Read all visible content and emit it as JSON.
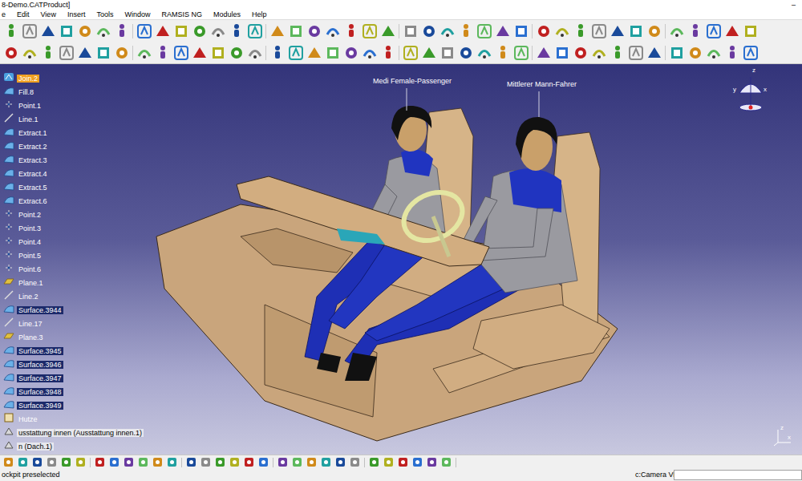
{
  "window": {
    "title": "8-Demo.CATProduct]",
    "minimize": "–"
  },
  "menu": [
    "e",
    "Edit",
    "View",
    "Insert",
    "Tools",
    "Window",
    "RAMSIS NG",
    "Modules",
    "Help"
  ],
  "tree": {
    "items": [
      {
        "label": "Join.2",
        "kind": "join",
        "selected": false,
        "current": true
      },
      {
        "label": "Fill.8",
        "kind": "surface",
        "selected": false,
        "current": false
      },
      {
        "label": "Point.1",
        "kind": "point",
        "selected": false,
        "current": false
      },
      {
        "label": "Line.1",
        "kind": "line",
        "selected": false,
        "current": false
      },
      {
        "label": "Extract.1",
        "kind": "surface",
        "selected": false,
        "current": false
      },
      {
        "label": "Extract.2",
        "kind": "surface",
        "selected": false,
        "current": false
      },
      {
        "label": "Extract.3",
        "kind": "surface",
        "selected": false,
        "current": false
      },
      {
        "label": "Extract.4",
        "kind": "surface",
        "selected": false,
        "current": false
      },
      {
        "label": "Extract.5",
        "kind": "surface",
        "selected": false,
        "current": false
      },
      {
        "label": "Extract.6",
        "kind": "surface",
        "selected": false,
        "current": false
      },
      {
        "label": "Point.2",
        "kind": "point",
        "selected": false,
        "current": false
      },
      {
        "label": "Point.3",
        "kind": "point",
        "selected": false,
        "current": false
      },
      {
        "label": "Point.4",
        "kind": "point",
        "selected": false,
        "current": false
      },
      {
        "label": "Point.5",
        "kind": "point",
        "selected": false,
        "current": false
      },
      {
        "label": "Point.6",
        "kind": "point",
        "selected": false,
        "current": false
      },
      {
        "label": "Plane.1",
        "kind": "plane",
        "selected": false,
        "current": false
      },
      {
        "label": "Line.2",
        "kind": "line",
        "selected": false,
        "current": false
      },
      {
        "label": "Surface.3944",
        "kind": "surface",
        "selected": true,
        "current": false
      },
      {
        "label": "Line.17",
        "kind": "line",
        "selected": false,
        "current": false
      },
      {
        "label": "Plane.3",
        "kind": "plane",
        "selected": false,
        "current": false
      },
      {
        "label": "Surface.3945",
        "kind": "surface",
        "selected": true,
        "current": false
      },
      {
        "label": "Surface.3946",
        "kind": "surface",
        "selected": true,
        "current": false
      },
      {
        "label": "Surface.3947",
        "kind": "surface",
        "selected": true,
        "current": false
      },
      {
        "label": "Surface.3948",
        "kind": "surface",
        "selected": true,
        "current": false
      },
      {
        "label": "Surface.3949",
        "kind": "surface",
        "selected": true,
        "current": false
      },
      {
        "label": "Hutze",
        "kind": "part",
        "selected": false,
        "current": false
      },
      {
        "label": "usstattung innen (Ausstattung innen.1)",
        "kind": "product",
        "selected": false,
        "current": false
      },
      {
        "label": "n (Dach.1)",
        "kind": "product",
        "selected": false,
        "current": false
      }
    ]
  },
  "viewport": {
    "annotations": [
      {
        "label": "Medi Female-Passenger"
      },
      {
        "label": "Mittlerer Mann-Fahrer"
      }
    ],
    "compass": {
      "z": "z",
      "x": "x",
      "y": "y"
    },
    "axis": {
      "z": "z",
      "x": "x"
    }
  },
  "status_bar": {
    "message": "ockpit preselected",
    "view": "c:Camera View",
    "input": ""
  }
}
